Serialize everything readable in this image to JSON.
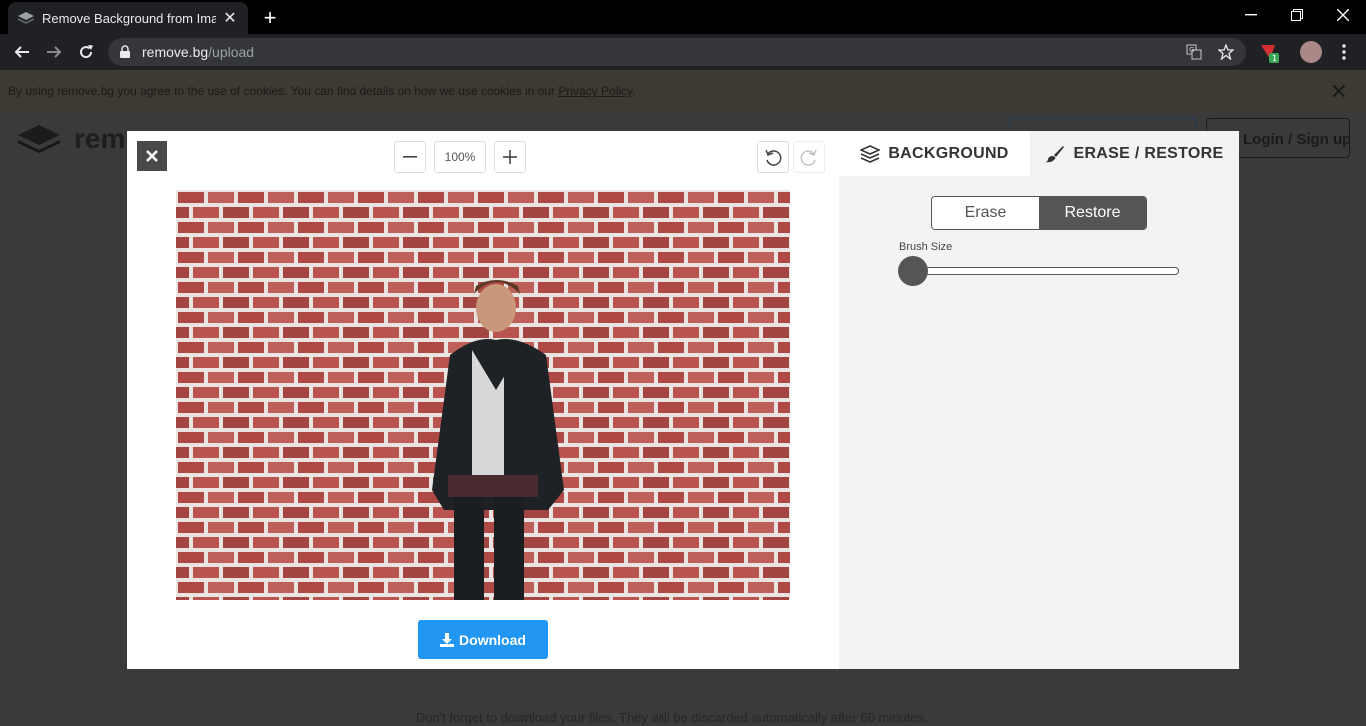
{
  "browser": {
    "tab_title": "Remove Background from Image",
    "tab_close": "✕",
    "new_tab": "+",
    "url_domain": "remove.bg",
    "url_path": "/upload",
    "extension_badge": "1"
  },
  "cookie_bar": {
    "text": "By using remove.bg you agree to the use of cookies. You can find details on how we use cookies in our ",
    "link": "Privacy Policy",
    "suffix": "."
  },
  "background_page": {
    "brand": "remove",
    "login_button": "Login / Sign up",
    "note": "Don't forget to download your files. They will be discarded automatically after 60 minutes."
  },
  "editor": {
    "zoom": "100%",
    "download_label": "Download",
    "tabs": [
      {
        "label": "BACKGROUND",
        "icon": "layers-icon"
      },
      {
        "label": "ERASE / RESTORE",
        "icon": "brush-icon",
        "active": true
      }
    ],
    "mode_erase": "Erase",
    "mode_restore": "Restore",
    "active_mode": "Restore",
    "brush_size_label": "Brush Size",
    "brush_size_level": 0
  }
}
